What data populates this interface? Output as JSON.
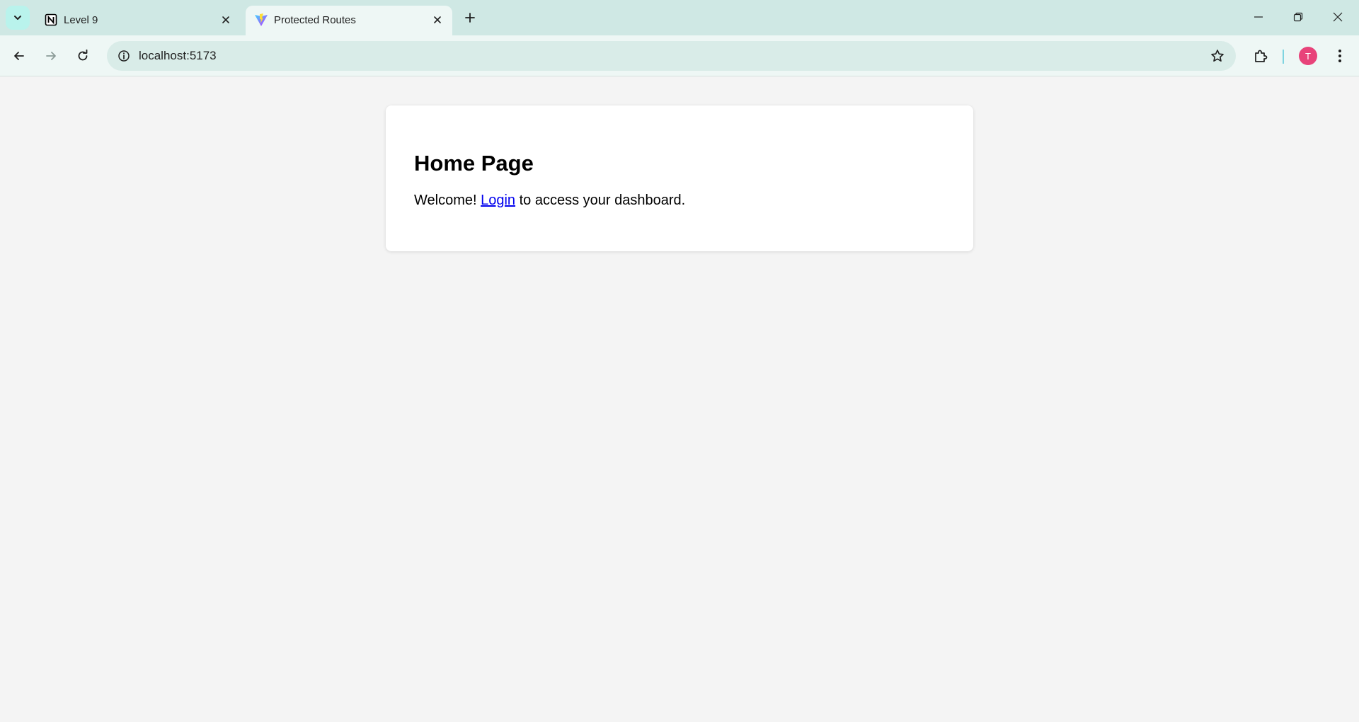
{
  "browser": {
    "tabs": [
      {
        "title": "Level 9",
        "favicon": "notion-icon",
        "active": false
      },
      {
        "title": "Protected Routes",
        "favicon": "vite-icon",
        "active": true
      }
    ],
    "address_bar": {
      "url": "localhost:5173"
    },
    "profile_initial": "T"
  },
  "page": {
    "heading": "Home Page",
    "welcome_prefix": "Welcome!",
    "login_link": "Login",
    "welcome_suffix": "to access your dashboard."
  },
  "colors": {
    "tabstrip": "#cfe8e4",
    "toolbar": "#eef7f5",
    "omnibox": "#d9ece8",
    "avatar": "#e8437a",
    "link": "#0000ee",
    "page_background": "#f4f4f4"
  }
}
